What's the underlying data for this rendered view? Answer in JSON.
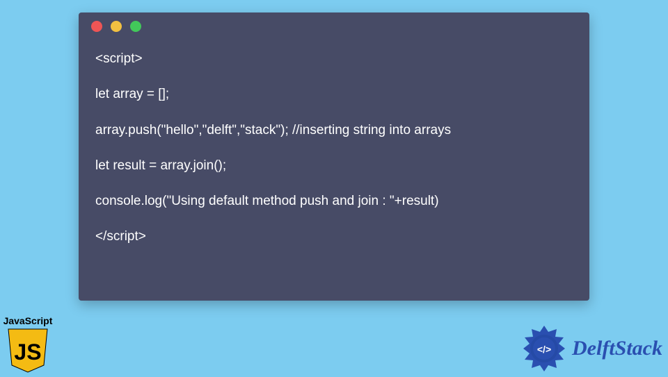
{
  "code_lines": [
    "<script>",
    "",
    "let array = [];",
    "",
    "array.push(\"hello\",\"delft\",\"stack\"); //inserting string into arrays",
    "",
    "let result = array.join();",
    "",
    "console.log(\"Using default method push and join : \"+result)",
    "",
    "</script>"
  ],
  "js_badge": {
    "label": "JavaScript",
    "shield_text": "JS"
  },
  "delft": {
    "brand": "DelftStack",
    "icon_glyph": "</>"
  },
  "colors": {
    "page_bg": "#7cccf0",
    "window_bg": "#474b66",
    "code_text": "#ffffff",
    "js_shield": "#f4bb13",
    "delft_blue": "#2a4fb0"
  }
}
